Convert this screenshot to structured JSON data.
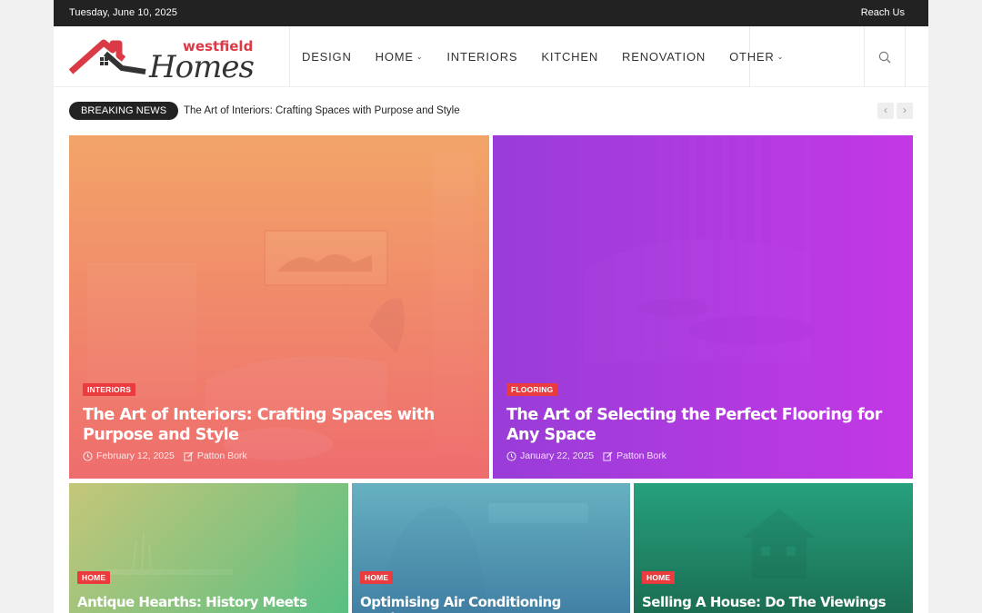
{
  "topbar": {
    "date": "Tuesday, June 10, 2025",
    "reach_us": "Reach Us"
  },
  "logo": {
    "line1": "westfield",
    "line2": "Homes"
  },
  "nav": [
    {
      "label": "DESIGN",
      "dropdown": false
    },
    {
      "label": "HOME",
      "dropdown": true
    },
    {
      "label": "INTERIORS",
      "dropdown": false
    },
    {
      "label": "KITCHEN",
      "dropdown": false
    },
    {
      "label": "RENOVATION",
      "dropdown": false
    },
    {
      "label": "OTHER",
      "dropdown": true
    }
  ],
  "icons": {
    "search": "search-icon",
    "dropdown": "chevron-down-icon",
    "clock": "clock-icon",
    "author": "edit-icon",
    "prev": "chevron-left-icon",
    "next": "chevron-right-icon"
  },
  "breaking": {
    "label": "BREAKING NEWS",
    "headline": "The Art of Interiors: Crafting Spaces with Purpose and Style",
    "prev": "‹",
    "next": "›"
  },
  "colors": {
    "brand_red": "#ea3c3f",
    "topbar": "#222222",
    "card1": [
      "#f2a769",
      "#ef6b6d"
    ],
    "card2": [
      "#9b3fd6",
      "#c43be0"
    ],
    "card3": [
      "#c9c87c",
      "#4fbf83"
    ],
    "card4": [
      "#6fb7c6",
      "#3f7d9e"
    ],
    "card5": [
      "#29a78a",
      "#1d6b52"
    ]
  },
  "featured": [
    {
      "category": "INTERIORS",
      "title": "The Art of Interiors: Crafting Spaces with Purpose and Style",
      "date": "February 12, 2025",
      "author": "Patton Bork"
    },
    {
      "category": "FLOORING",
      "title": "The Art of Selecting the Perfect Flooring for Any Space",
      "date": "January 22, 2025",
      "author": "Patton Bork"
    }
  ],
  "posts": [
    {
      "category": "HOME",
      "title": "Antique Hearths: History Meets"
    },
    {
      "category": "HOME",
      "title": "Optimising Air Conditioning Settings"
    },
    {
      "category": "HOME",
      "title": "Selling A House: Do The Viewings"
    }
  ]
}
